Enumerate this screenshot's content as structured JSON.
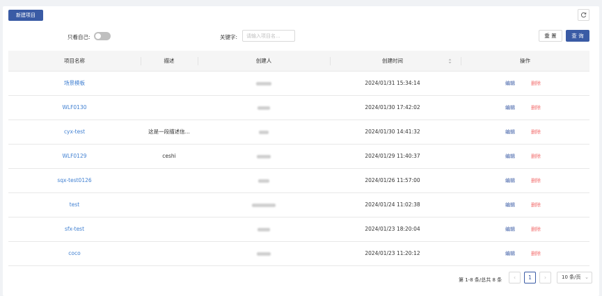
{
  "toolbar": {
    "new_project_label": "新建项目"
  },
  "filters": {
    "only_mine_label": "只看自己:",
    "only_mine_on": false,
    "keyword_label": "关键字:",
    "keyword_placeholder": "请输入项目名...",
    "keyword_value": "",
    "reset_label": "重 置",
    "query_label": "查 询"
  },
  "table": {
    "columns": [
      "项目名称",
      "描述",
      "创建人",
      "创建时间",
      "操作"
    ],
    "rows": [
      {
        "name": "场景模板",
        "desc": "",
        "created": "2024/01/31 15:34:14",
        "edit": "编辑",
        "delete": "删除"
      },
      {
        "name": "WLF0130",
        "desc": "",
        "created": "2024/01/30 17:42:02",
        "edit": "编辑",
        "delete": "删除"
      },
      {
        "name": "cyx-test",
        "desc": "这是一段描述信...",
        "created": "2024/01/30 14:41:32",
        "edit": "编辑",
        "delete": "删除"
      },
      {
        "name": "WLF0129",
        "desc": "ceshi",
        "created": "2024/01/29 11:40:37",
        "edit": "编辑",
        "delete": "删除"
      },
      {
        "name": "sqx-test0126",
        "desc": "",
        "created": "2024/01/26 11:57:00",
        "edit": "编辑",
        "delete": "删除"
      },
      {
        "name": "test",
        "desc": "",
        "created": "2024/01/24 11:02:38",
        "edit": "编辑",
        "delete": "删除"
      },
      {
        "name": "sfx-test",
        "desc": "",
        "created": "2024/01/23 18:20:04",
        "edit": "编辑",
        "delete": "删除"
      },
      {
        "name": "coco",
        "desc": "",
        "created": "2024/01/23 11:20:12",
        "edit": "编辑",
        "delete": "删除"
      }
    ]
  },
  "pagination": {
    "summary": "第 1-8 条/总共 8 条",
    "current_page": "1",
    "page_size": "10 条/页"
  },
  "icons": {
    "refresh": "refresh-icon",
    "sort": "sort-icon",
    "prev": "chevron-left-icon",
    "next": "chevron-right-icon",
    "dropdown": "chevron-down-icon"
  },
  "colors": {
    "primary": "#3a5ba5",
    "link": "#3f7fd1",
    "danger": "#f26d6d"
  }
}
